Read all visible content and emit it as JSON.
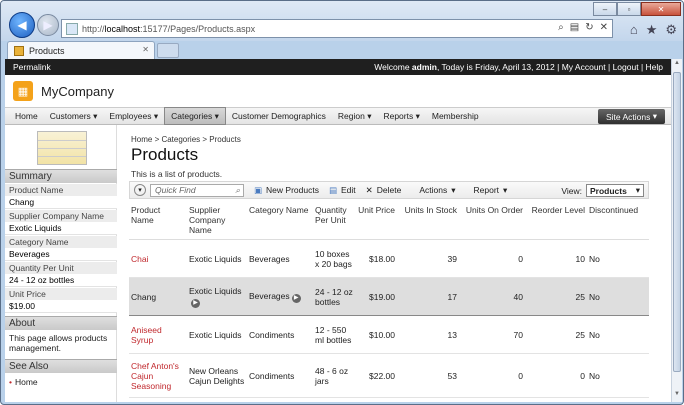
{
  "browser": {
    "url_prefix": "http://",
    "url_host": "localhost",
    "url_rest": ":15177/Pages/Products.aspx",
    "tab_title": "Products"
  },
  "topbar": {
    "permalink": "Permalink",
    "welcome_prefix": "Welcome ",
    "user": "admin",
    "welcome_suffix": ", Today is Friday, April 13, 2012",
    "my_account": "My Account",
    "logout": "Logout",
    "help": "Help"
  },
  "brand": {
    "name": "MyCompany"
  },
  "menu": {
    "home": "Home",
    "customers": "Customers",
    "employees": "Employees",
    "categories": "Categories",
    "customer_demographics": "Customer Demographics",
    "region": "Region",
    "reports": "Reports",
    "membership": "Membership",
    "site_actions": "Site Actions"
  },
  "sidebar": {
    "summary": "Summary",
    "fields": [
      {
        "label": "Product Name",
        "value": "Chang"
      },
      {
        "label": "Supplier Company Name",
        "value": "Exotic Liquids"
      },
      {
        "label": "Category Name",
        "value": "Beverages"
      },
      {
        "label": "Quantity Per Unit",
        "value": "24 - 12 oz bottles"
      },
      {
        "label": "Unit Price",
        "value": "$19.00"
      }
    ],
    "about_title": "About",
    "about_text": "This page allows products management.",
    "see_also_title": "See Also",
    "see_also_item": "Home"
  },
  "page": {
    "breadcrumb": "Home > Categories > Products",
    "title": "Products",
    "description": "This is a list of products."
  },
  "toolbar": {
    "quick_find": "Quick Find",
    "new_products": "New Products",
    "edit": "Edit",
    "delete": "Delete",
    "actions": "Actions",
    "report": "Report",
    "view_label": "View:",
    "view_value": "Products"
  },
  "table": {
    "headers": [
      "Product Name",
      "Supplier Company Name",
      "Category Name",
      "Quantity Per Unit",
      "Unit Price",
      "Units In Stock",
      "Units On Order",
      "Reorder Level",
      "Discontinued"
    ],
    "rows": [
      [
        "Chai",
        "Exotic Liquids",
        "Beverages",
        "10 boxes x 20 bags",
        "$18.00",
        "39",
        "0",
        "10",
        "No"
      ],
      [
        "Chang",
        "Exotic Liquids",
        "Beverages",
        "24 - 12 oz bottles",
        "$19.00",
        "17",
        "40",
        "25",
        "No"
      ],
      [
        "Aniseed Syrup",
        "Exotic Liquids",
        "Condiments",
        "12 - 550 ml bottles",
        "$10.00",
        "13",
        "70",
        "25",
        "No"
      ],
      [
        "Chef Anton's Cajun Seasoning",
        "New Orleans Cajun Delights",
        "Condiments",
        "48 - 6 oz jars",
        "$22.00",
        "53",
        "0",
        "0",
        "No"
      ]
    ]
  },
  "colors": {
    "accent": "#c0282d",
    "topbar": "#1f1f1f",
    "logo": "#f4a21a"
  }
}
